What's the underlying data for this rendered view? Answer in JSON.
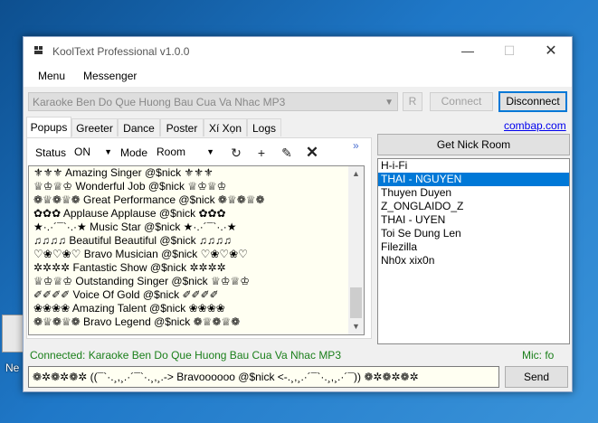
{
  "desktop": {
    "icon_label": "Ne"
  },
  "window": {
    "title": "KoolText Professional v1.0.0",
    "controls": {
      "minimize": "—",
      "maximize": "☐",
      "close": "✕"
    }
  },
  "menu": {
    "items": [
      "Menu",
      "Messenger"
    ]
  },
  "server": {
    "selected": "Karaoke Ben Do Que Huong Bau Cua Va Nhac MP3",
    "r_label": "R",
    "connect_label": "Connect",
    "disconnect_label": "Disconnect"
  },
  "tabs": [
    "Popups",
    "Greeter",
    "Dance",
    "Poster",
    "Xí Xọn",
    "Logs"
  ],
  "popups": {
    "status_label": "Status",
    "status_value": "ON",
    "mode_label": "Mode",
    "mode_value": "Room",
    "tool_refresh": "↻",
    "tool_add": "+",
    "tool_edit": "✎",
    "tool_delete": "✕",
    "expand": "»",
    "items": [
      "⚜⚜⚜ Amazing Singer @$nick ⚜⚜⚜",
      "♕♔♕♔ Wonderful Job @$nick ♕♔♕♔",
      "❁♕❁♕❁ Great Performance @$nick ❁♕❁♕❁",
      "✿✿✿ Applause Applause @$nick ✿✿✿",
      "★·.·´¯`·.·★ Music Star @$nick ★·.·´¯`·.·★",
      "♫♫♫♫ Beautiful Beautiful @$nick ♫♫♫♫",
      "♡❀♡❀♡ Bravo Musician @$nick ♡❀♡❀♡",
      "✲✲✲✲ Fantastic Show @$nick ✲✲✲✲",
      "♕♔♕♔ Outstanding Singer @$nick ♕♔♕♔",
      "✐✐✐✐ Voice Of Gold @$nick ✐✐✐✐",
      "❀❀❀❀ Amazing Talent @$nick ❀❀❀❀",
      "❁♕❁♕❁ Bravo Legend @$nick ❁♕❁♕❁"
    ]
  },
  "right": {
    "link_label": "combap.com",
    "get_nick_label": "Get Nick Room",
    "nicks": [
      "H-i-Fi",
      "THAI - NGUYEN",
      "Thuyen Duyen",
      "Z_ONGLAIDO_Z",
      "THAI - UYEN",
      "Toi Se Dung Len",
      "Filezilla",
      "Nh0x xix0n"
    ],
    "selected_index": 1
  },
  "status": {
    "connected_text": "Connected: Karaoke Ben Do Que Huong Bau Cua Va Nhac MP3",
    "mic_text": "Mic: fo"
  },
  "message": {
    "value": "❁✲❁✲❁✲ ((¯`·.¸,¸.·´¯`·.¸,¸.-> Bravoooooo @$nick <-.¸,¸.·´¯`·.¸,¸.·´¯)) ❁✲❁✲❁✲",
    "send_label": "Send"
  },
  "colors": {
    "accent": "#0078d7",
    "status_green": "#1a7f1a",
    "list_bg": "#fffff2"
  }
}
